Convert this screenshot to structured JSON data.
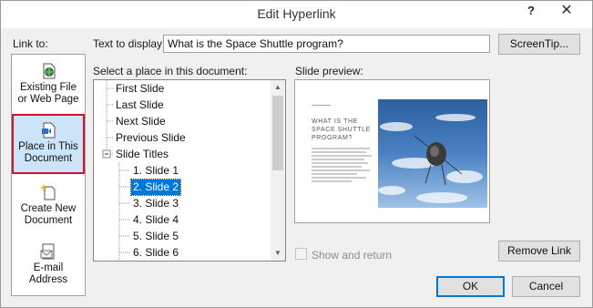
{
  "dialog": {
    "title": "Edit Hyperlink",
    "help_glyph": "?",
    "close_glyph": "✕"
  },
  "link_to": {
    "label": "Link to:",
    "items": [
      {
        "line1": "Existing File",
        "line2": "or Web Page",
        "icon": "globe-file-icon",
        "selected": false
      },
      {
        "line1": "Place in This",
        "line2": "Document",
        "icon": "document-place-icon",
        "selected": true
      },
      {
        "line1": "Create New",
        "line2": "Document",
        "icon": "new-document-icon",
        "selected": false
      },
      {
        "line1": "E-mail",
        "line2": "Address",
        "icon": "email-icon",
        "selected": false
      }
    ]
  },
  "text_to_display": {
    "label": "Text to display:",
    "value": "What is the Space Shuttle program?"
  },
  "buttons": {
    "screentip": "ScreenTip...",
    "remove_link": "Remove Link",
    "ok": "OK",
    "cancel": "Cancel"
  },
  "place_list": {
    "label": "Select a place in this document:",
    "items": [
      {
        "text": "First Slide"
      },
      {
        "text": "Last Slide"
      },
      {
        "text": "Next Slide"
      },
      {
        "text": "Previous Slide"
      },
      {
        "text": "Slide Titles"
      },
      {
        "text": "1. Slide 1"
      },
      {
        "text": "2. Slide 2",
        "selected": true
      },
      {
        "text": "3. Slide 3"
      },
      {
        "text": "4. Slide 4"
      },
      {
        "text": "5. Slide 5"
      },
      {
        "text": "6. Slide 6"
      }
    ],
    "expander_glyph": "−"
  },
  "preview": {
    "label": "Slide preview:",
    "slide_title": "WHAT IS THE SPACE SHUTTLE PROGRAM?"
  },
  "show_and_return": {
    "label": "Show and return",
    "checked": false
  },
  "colors": {
    "selection": "#0078d7",
    "linkto_selected_bg": "#cce4f7",
    "linkto_selected_border": "#d1132f"
  }
}
